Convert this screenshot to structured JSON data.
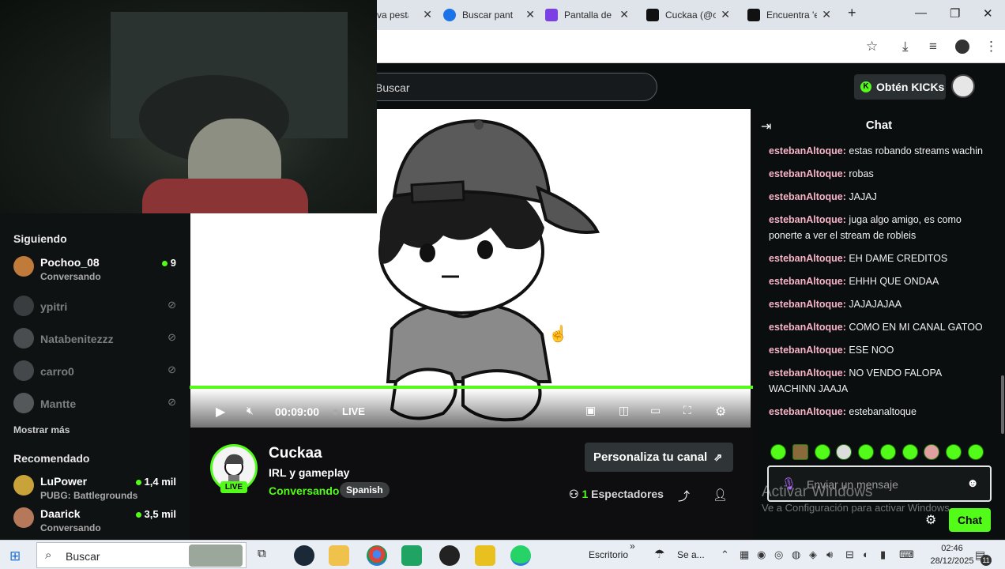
{
  "browser": {
    "tabs": [
      {
        "label": "va pesta"
      },
      {
        "label": "Buscar pant"
      },
      {
        "label": "Pantalla de t"
      },
      {
        "label": "Cuckaa (@c"
      },
      {
        "label": "Encuentra 'e"
      }
    ],
    "new_tab": "+"
  },
  "header": {
    "search_placeholder": "Buscar",
    "kicks_label": "Obtén KICKs",
    "kicks_icon": "K"
  },
  "sidebar": {
    "following_title": "Siguiendo",
    "following": [
      {
        "name": "Pochoo_08",
        "status": "Conversando",
        "viewers": "9",
        "live": true
      },
      {
        "name": "ypitri",
        "live": false
      },
      {
        "name": "Natabenitezzz",
        "live": false
      },
      {
        "name": "carro0",
        "live": false
      },
      {
        "name": "Mantte",
        "live": false
      }
    ],
    "show_more": "Mostrar más",
    "recommended_title": "Recomendado",
    "recommended": [
      {
        "name": "LuPower",
        "status": "PUBG: Battlegrounds",
        "viewers": "1,4 mil"
      },
      {
        "name": "Daarick",
        "status": "Conversando",
        "viewers": "3,5 mil"
      }
    ]
  },
  "player": {
    "time": "00:09:00",
    "live_label": "LIVE",
    "progress": 1.0
  },
  "channel": {
    "name": "Cuckaa",
    "title": "IRL y gameplay",
    "category": "Conversando",
    "language": "Spanish",
    "live_badge": "LIVE",
    "customize_button": "Personaliza tu canal",
    "viewer_count": "1",
    "viewer_label": "Espectadores"
  },
  "chat": {
    "title": "Chat",
    "messages": [
      {
        "user": "estebanAltoque:",
        "text": "estas robando streams wachin"
      },
      {
        "user": "estebanAltoque:",
        "text": "robas"
      },
      {
        "user": "estebanAltoque:",
        "text": "JAJAJ"
      },
      {
        "user": "estebanAltoque:",
        "text": "juga algo amigo, es como ponerte a ver el stream de robleis"
      },
      {
        "user": "estebanAltoque:",
        "text": "EH DAME CREDITOS"
      },
      {
        "user": "estebanAltoque:",
        "text": "EHHH QUE ONDAA"
      },
      {
        "user": "estebanAltoque:",
        "text": "JAJAJAJAA"
      },
      {
        "user": "estebanAltoque:",
        "text": "COMO EN MI CANAL GATOO"
      },
      {
        "user": "estebanAltoque:",
        "text": "ESE NOO"
      },
      {
        "user": "estebanAltoque:",
        "text": "NO VENDO FALOPA WACHINN JAAJA"
      },
      {
        "user": "estebanAltoque:",
        "text": "estebanaltoque"
      }
    ],
    "input_placeholder": "Enviar un mensaje",
    "send_button": "Chat",
    "watermark_title": "Activar Windows",
    "watermark_sub": "Ve a Configuración para activar Windows."
  },
  "taskbar": {
    "search_label": "Buscar",
    "desktop_label": "Escritorio",
    "weather_label": "Se a...",
    "time": "02:46",
    "date": "28/12/2025",
    "notification_count": "11"
  },
  "colors": {
    "accent": "#53fc18",
    "background": "#0e0e10",
    "chat_username": "#f8b4c8"
  }
}
